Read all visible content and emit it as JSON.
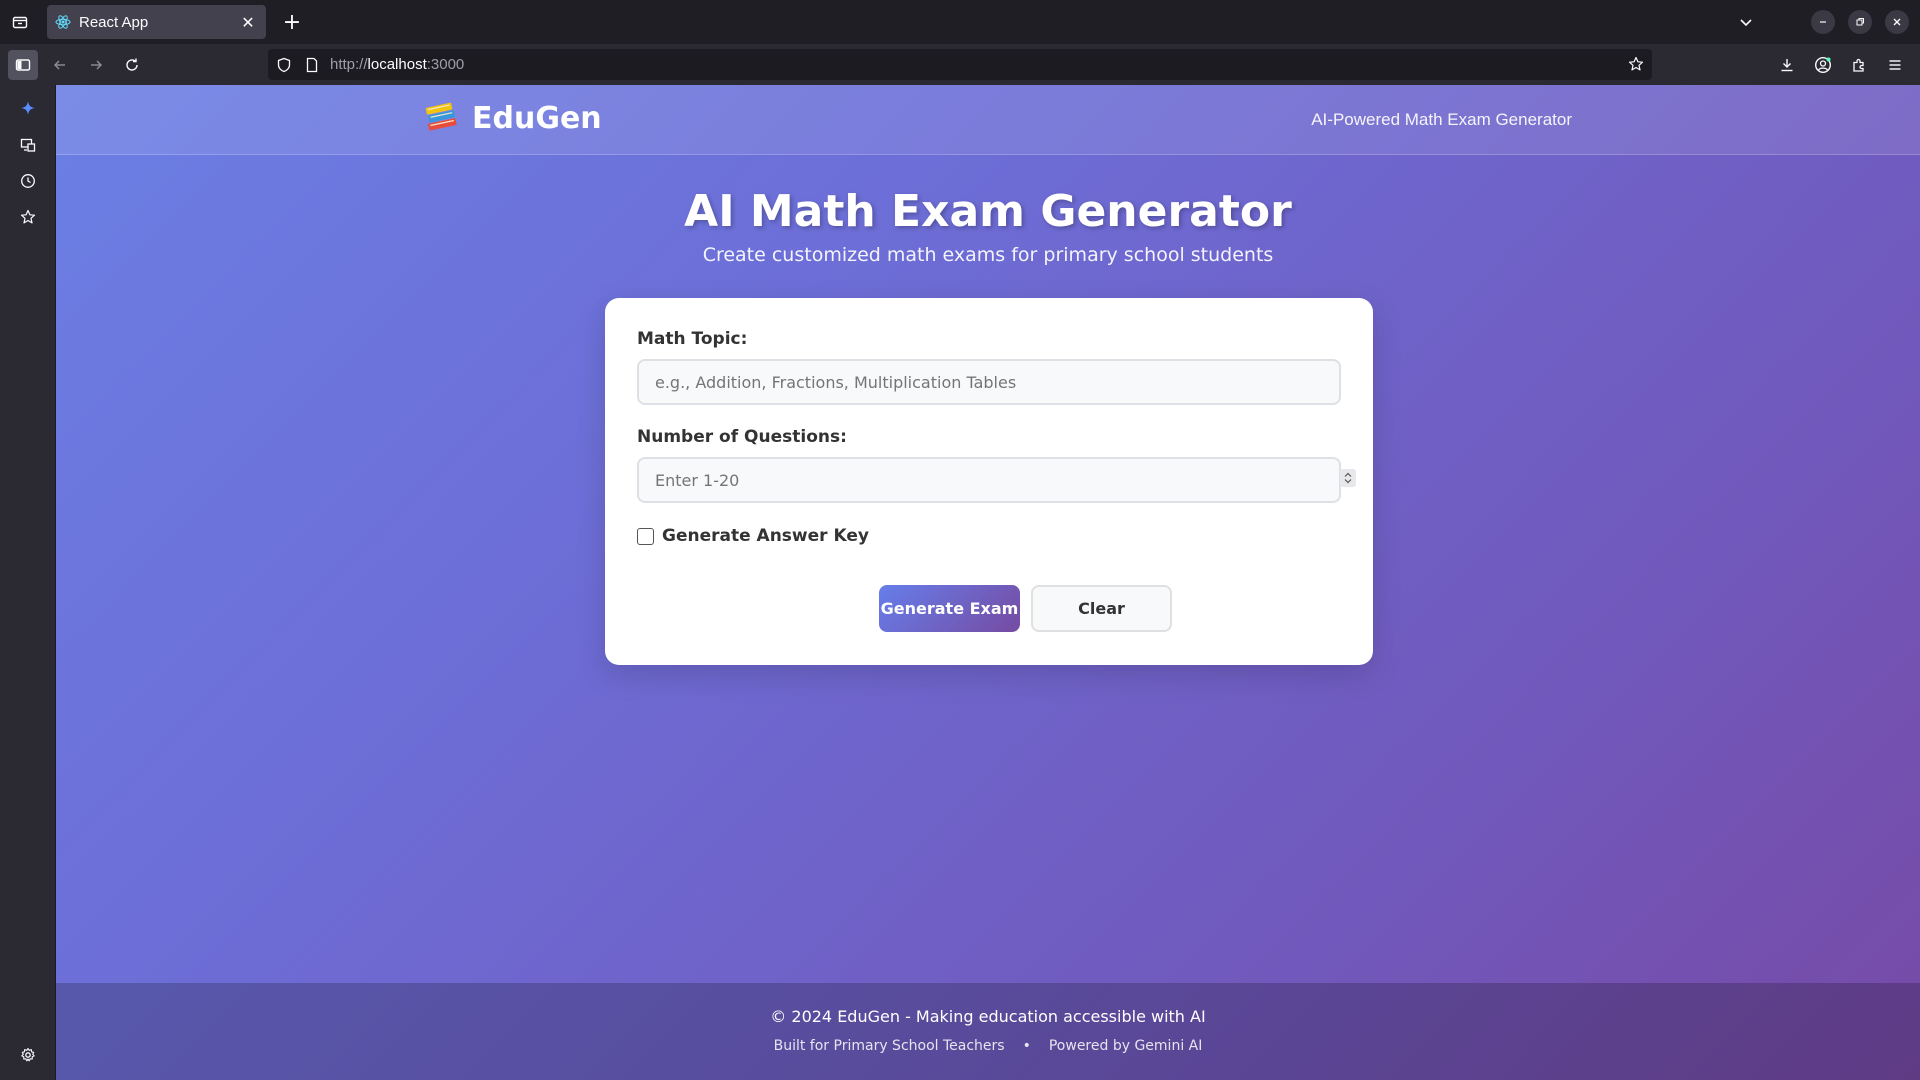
{
  "browser": {
    "tab_title": "React App",
    "url_scheme": "http://",
    "url_host": "localhost",
    "url_port": ":3000",
    "icons": [
      "tab-list-icon",
      "react-favicon-icon",
      "close-icon",
      "plus-icon",
      "chevron-down-icon",
      "minimize-icon",
      "restore-icon",
      "close-window-icon",
      "sidebar-icon",
      "back-arrow-icon",
      "forward-arrow-icon",
      "reload-icon",
      "shield-icon",
      "page-icon",
      "bookmark-star-icon",
      "download-icon",
      "account-icon",
      "extensions-icon",
      "menu-icon"
    ]
  },
  "sidebar": {
    "icons": [
      "ai-sparkle-icon",
      "synced-tabs-icon",
      "history-icon",
      "bookmarks-icon",
      "settings-icon"
    ]
  },
  "header": {
    "logo_icon": "books-icon",
    "brand": "EduGen",
    "tagline": "AI-Powered Math Exam Generator"
  },
  "hero": {
    "title": "AI Math Exam Generator",
    "subtitle": "Create customized math exams for primary school students"
  },
  "form": {
    "topic_label": "Math Topic:",
    "topic_placeholder": "e.g., Addition, Fractions, Multiplication Tables",
    "topic_value": "",
    "count_label": "Number of Questions:",
    "count_placeholder": "Enter 1-20",
    "count_value": "",
    "answer_key_label": "Generate Answer Key",
    "answer_key_checked": false,
    "generate_label": "Generate Exam",
    "clear_label": "Clear"
  },
  "footer": {
    "copyright": "© 2024 EduGen - Making education accessible with AI",
    "built_for": "Built for Primary School Teachers",
    "separator": "•",
    "powered_by": "Powered by Gemini AI"
  },
  "colors": {
    "gradient_start": "#667eea",
    "gradient_end": "#764ba2",
    "card_bg": "#ffffff"
  }
}
